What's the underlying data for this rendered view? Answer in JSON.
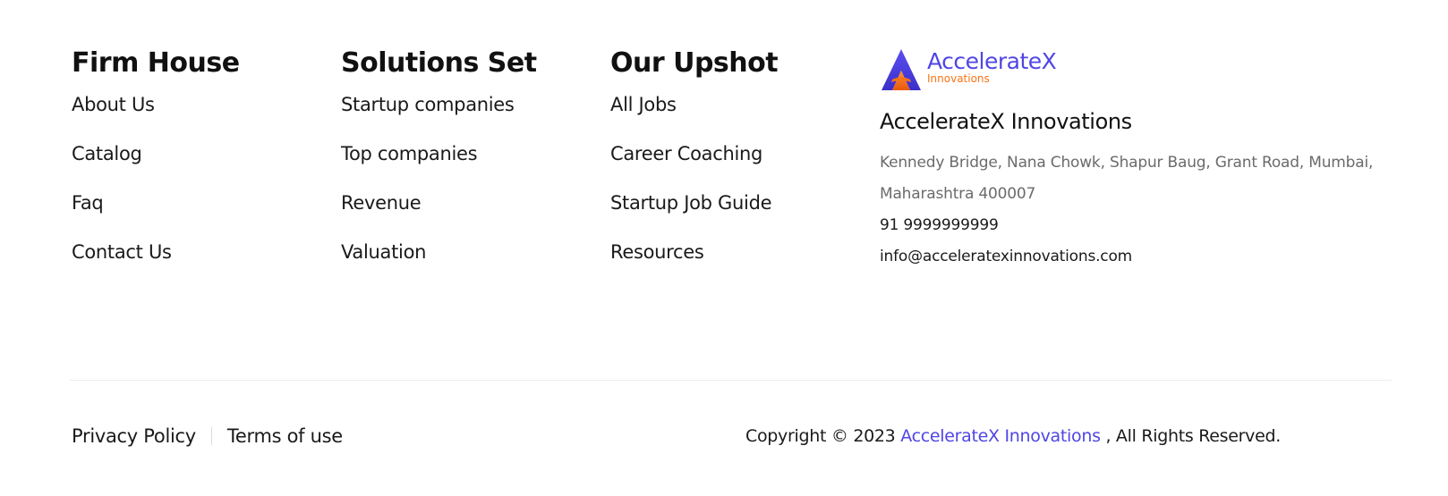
{
  "columns": [
    {
      "heading": "Firm House",
      "links": [
        "About Us",
        "Catalog",
        "Faq",
        "Contact Us"
      ]
    },
    {
      "heading": "Solutions Set",
      "links": [
        "Startup companies",
        "Top companies",
        "Revenue",
        "Valuation"
      ]
    },
    {
      "heading": "Our Upshot",
      "links": [
        "All Jobs",
        "Career Coaching",
        "Startup Job Guide",
        "Resources"
      ]
    }
  ],
  "brand": {
    "logo_word": "AccelerateX",
    "logo_sub": "Innovations",
    "name": "AccelerateX Innovations",
    "address": "Kennedy Bridge, Nana Chowk, Shapur Baug, Grant Road, Mumbai, Maharashtra 400007",
    "phone": "91 9999999999",
    "email": "info@acceleratexinnovations.com",
    "colors": {
      "primary": "#4f46e5",
      "accent": "#f97316"
    }
  },
  "bottom_bar": {
    "privacy_label": "Privacy Policy",
    "terms_label": "Terms of use",
    "copyright_prefix": "Copyright © 2023",
    "copyright_brand": "AccelerateX Innovations",
    "copyright_suffix": ", All Rights Reserved."
  }
}
